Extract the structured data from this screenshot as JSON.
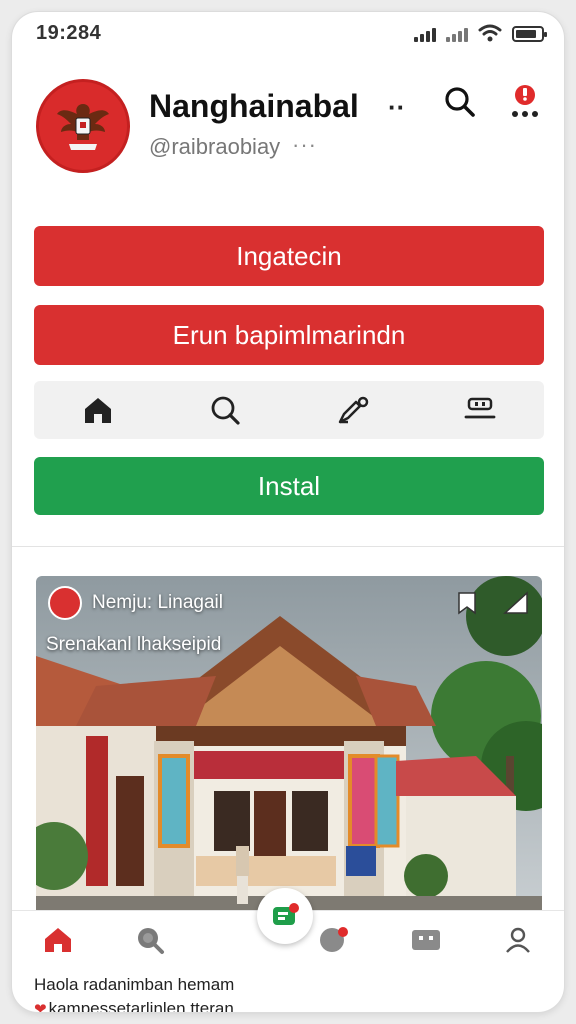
{
  "status_bar": {
    "time": "19:284"
  },
  "profile": {
    "name": "Nanghainabal",
    "name_more": "··",
    "handle": "@raibraobiay",
    "handle_more": "···"
  },
  "actions": {
    "primary_label": "Ingatecin",
    "secondary_label": "Erun bapimlmarindn",
    "install_label": "Instal"
  },
  "icon_bar": {
    "items": [
      "home-icon",
      "search-icon",
      "edit-icon",
      "inbox-icon"
    ]
  },
  "post": {
    "author": "Nemju: Linagail",
    "caption": "Srenakanl lhakseipid"
  },
  "bottom_nav": {
    "items": [
      "home-icon",
      "search-icon",
      "create-icon",
      "chat-icon",
      "messages-icon",
      "profile-icon"
    ]
  },
  "footer": {
    "line1": "Haola radanimban hemam",
    "line2": "kampessetarlinlen tteran"
  },
  "colors": {
    "accent_red": "#d93030",
    "accent_green": "#20a04e"
  }
}
